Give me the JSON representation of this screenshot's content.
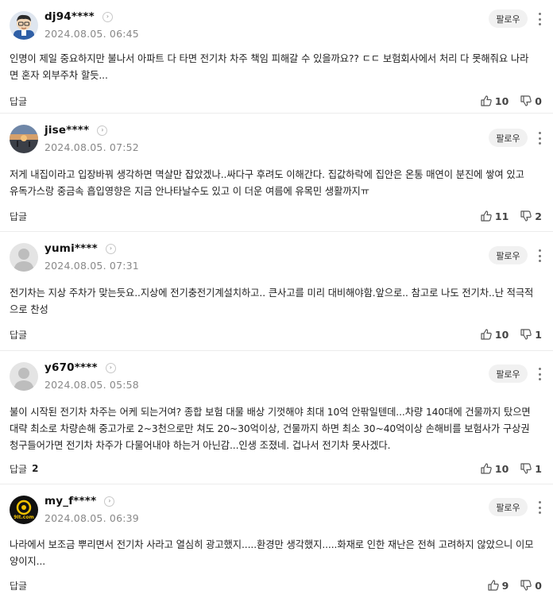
{
  "follow_label": "팔로우",
  "reply_label": "답글",
  "comments": [
    {
      "username": "dj94****",
      "date": "2024.08.05. 06:45",
      "text": "인명이 제일 중요하지만 불나서 아파트 다 타면 전기차 차주 책임 피해갈 수 있을까요?? ㄷㄷ 보험회사에서 처리 다 못해줘요 나라면 혼자 외부주차 할듯...",
      "reply_count": "",
      "likes": "10",
      "dislikes": "0",
      "avatar": "cartoon-man"
    },
    {
      "username": "jise****",
      "date": "2024.08.05. 07:52",
      "text": "저게 내집이라고 입장바꿔 생각하면 멱살만 잡았겠나..싸다구 후려도 이해간다. 집값하락에 집안은 온통 매연이 분진에 쌓여 있고 유독가스랑 중금속 흡입영향은 지금 안나타날수도 있고 이 더운 여름에 유목민 생활까지ㅠ",
      "reply_count": "",
      "likes": "11",
      "dislikes": "2",
      "avatar": "sunset-photo"
    },
    {
      "username": "yumi****",
      "date": "2024.08.05. 07:31",
      "text": "전기차는 지상 주차가 맞는듯요..지상에 전기충전기계설치하고.. 큰사고를 미리 대비해야함.앞으로.. 참고로 나도 전기차..난 적극적으로 찬성",
      "reply_count": "",
      "likes": "10",
      "dislikes": "1",
      "avatar": "default"
    },
    {
      "username": "y670****",
      "date": "2024.08.05. 05:58",
      "text": "불이 시작된 전기차 차주는 어케 되는거여? 종합 보험 대물 배상 기껏해야 최대 10억 안팎일텐데...차량 140대에 건물까지 탔으면 대략 최소로 차량손해 중고가로 2~3천으로만 쳐도 20~30억이상, 건물까지 하면 최소 30~40억이상 손해비를 보험사가 구상권 청구들어가면 전기차 차주가 다물어내야 하는거 아닌감...인생 조졌네. 겁나서 전기차 못사겠다.",
      "reply_count": "2",
      "likes": "10",
      "dislikes": "1",
      "avatar": "default"
    },
    {
      "username": "my_f****",
      "date": "2024.08.05. 06:39",
      "text": "나라에서 보조금 뿌리면서 전기차 사라고 열심히 광고했지.....환경만 생각했지.....화재로 인한 재난은 전혀 고려하지 않았으니 이모양이지...",
      "reply_count": "",
      "likes": "9",
      "dislikes": "0",
      "avatar": "logo",
      "avatar_text": "9It.com"
    }
  ]
}
